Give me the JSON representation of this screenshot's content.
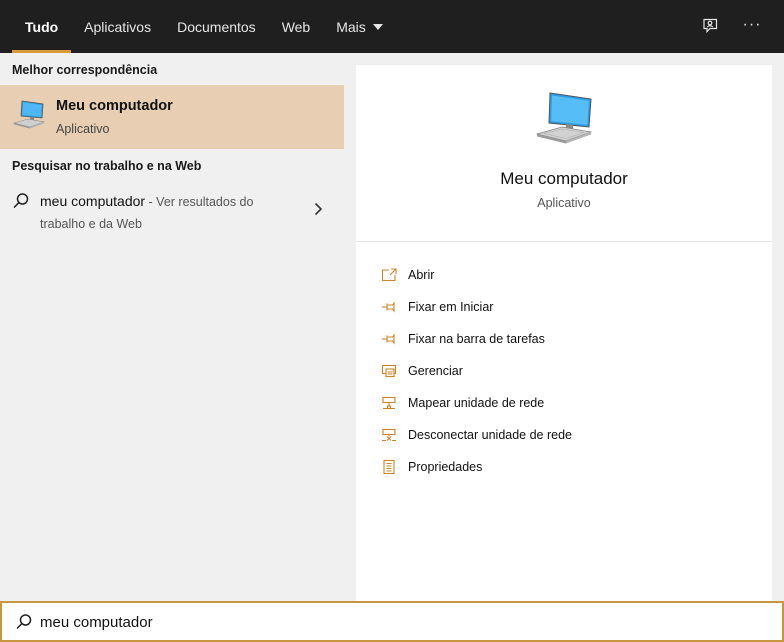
{
  "tabs": [
    {
      "label": "Tudo",
      "active": true
    },
    {
      "label": "Aplicativos",
      "active": false
    },
    {
      "label": "Documentos",
      "active": false
    },
    {
      "label": "Web",
      "active": false
    },
    {
      "label": "Mais",
      "active": false
    }
  ],
  "header_icons": {
    "feedback": "feedback-icon",
    "more": "more-options-icon",
    "more_glyph": "···"
  },
  "left": {
    "best_match_title": "Melhor correspondência",
    "best_match": {
      "name": "Meu computador",
      "type": "Aplicativo",
      "icon": "computer-icon"
    },
    "web_title": "Pesquisar no trabalho e na Web",
    "web_result": {
      "query": "meu computador",
      "hint": " - Ver resultados do trabalho e da Web",
      "icon": "search-icon"
    }
  },
  "preview": {
    "name": "Meu computador",
    "type": "Aplicativo",
    "icon": "computer-icon",
    "actions": [
      {
        "label": "Abrir",
        "icon": "open-icon"
      },
      {
        "label": "Fixar em Iniciar",
        "icon": "pin-icon"
      },
      {
        "label": "Fixar na barra de tarefas",
        "icon": "pin-icon"
      },
      {
        "label": "Gerenciar",
        "icon": "manage-icon"
      },
      {
        "label": "Mapear unidade de rede",
        "icon": "map-network-drive-icon"
      },
      {
        "label": "Desconectar unidade de rede",
        "icon": "disconnect-network-drive-icon"
      },
      {
        "label": "Propriedades",
        "icon": "properties-icon"
      }
    ]
  },
  "search": {
    "value": "meu computador",
    "icon": "search-icon"
  },
  "colors": {
    "accent": "#d89a3a",
    "selection": "#e8cfb3",
    "topbar": "#1f1f1f",
    "icon_orange": "#c8862a"
  }
}
